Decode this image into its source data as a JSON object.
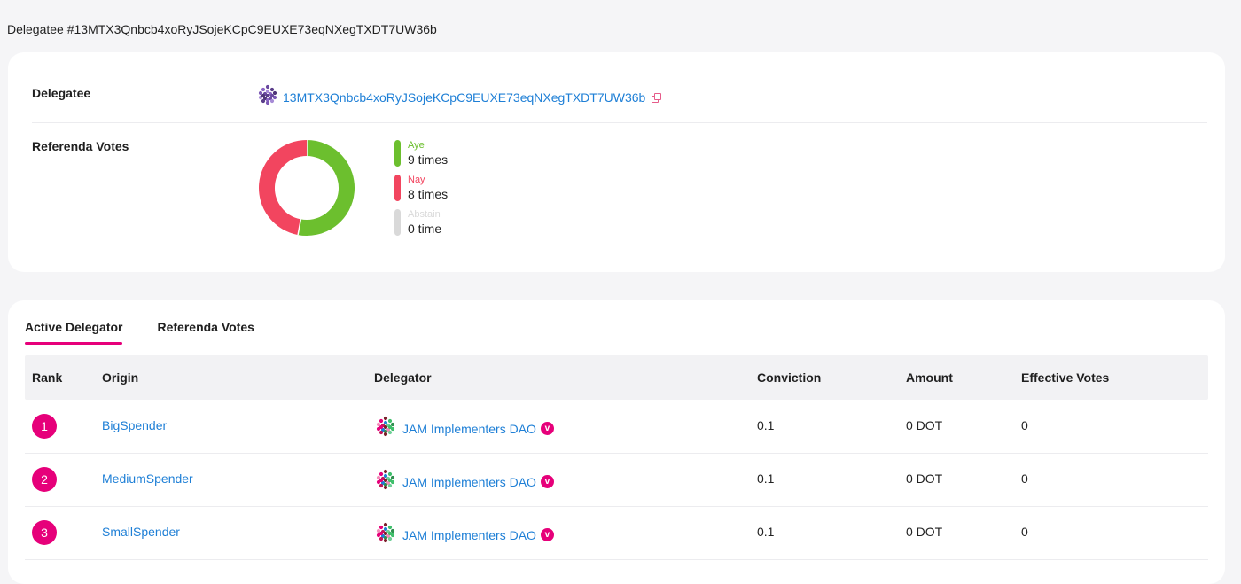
{
  "page": {
    "title": "Delegatee #13MTX3Qnbcb4xoRyJSojeKCpC9EUXE73eqNXegTXDT7UW36b"
  },
  "summary": {
    "delegatee_label": "Delegatee",
    "delegatee_address": "13MTX3Qnbcb4xoRyJSojeKCpC9EUXE73eqNXegTXDT7UW36b",
    "votes_label": "Referenda Votes",
    "legend": [
      {
        "name": "Aye",
        "count": "9 times",
        "value": 9,
        "color": "#6cbf2e"
      },
      {
        "name": "Nay",
        "count": "8 times",
        "value": 8,
        "color": "#f2455f"
      },
      {
        "name": "Abstain",
        "count": "0 time",
        "value": 0,
        "color": "#d9d9d9"
      }
    ]
  },
  "tabs": [
    {
      "label": "Active Delegator",
      "active": true
    },
    {
      "label": "Referenda Votes",
      "active": false
    }
  ],
  "table": {
    "columns": [
      "Rank",
      "Origin",
      "Delegator",
      "Conviction",
      "Amount",
      "Effective Votes"
    ],
    "rows": [
      {
        "rank": "1",
        "origin": "BigSpender",
        "delegator": "JAM Implementers DAO",
        "verified": "v",
        "conviction": "0.1",
        "amount": "0 DOT",
        "effective_votes": "0"
      },
      {
        "rank": "2",
        "origin": "MediumSpender",
        "delegator": "JAM Implementers DAO",
        "verified": "v",
        "conviction": "0.1",
        "amount": "0 DOT",
        "effective_votes": "0"
      },
      {
        "rank": "3",
        "origin": "SmallSpender",
        "delegator": "JAM Implementers DAO",
        "verified": "v",
        "conviction": "0.1",
        "amount": "0 DOT",
        "effective_votes": "0"
      }
    ]
  },
  "colors": {
    "accent": "#e6007a",
    "link": "#1e7fd6",
    "aye": "#6cbf2e",
    "nay": "#f2455f",
    "abstain": "#d9d9d9"
  },
  "icons": {
    "identicon": "identicon-icon",
    "copy": "copy-icon",
    "verified": "verified-badge-icon"
  }
}
